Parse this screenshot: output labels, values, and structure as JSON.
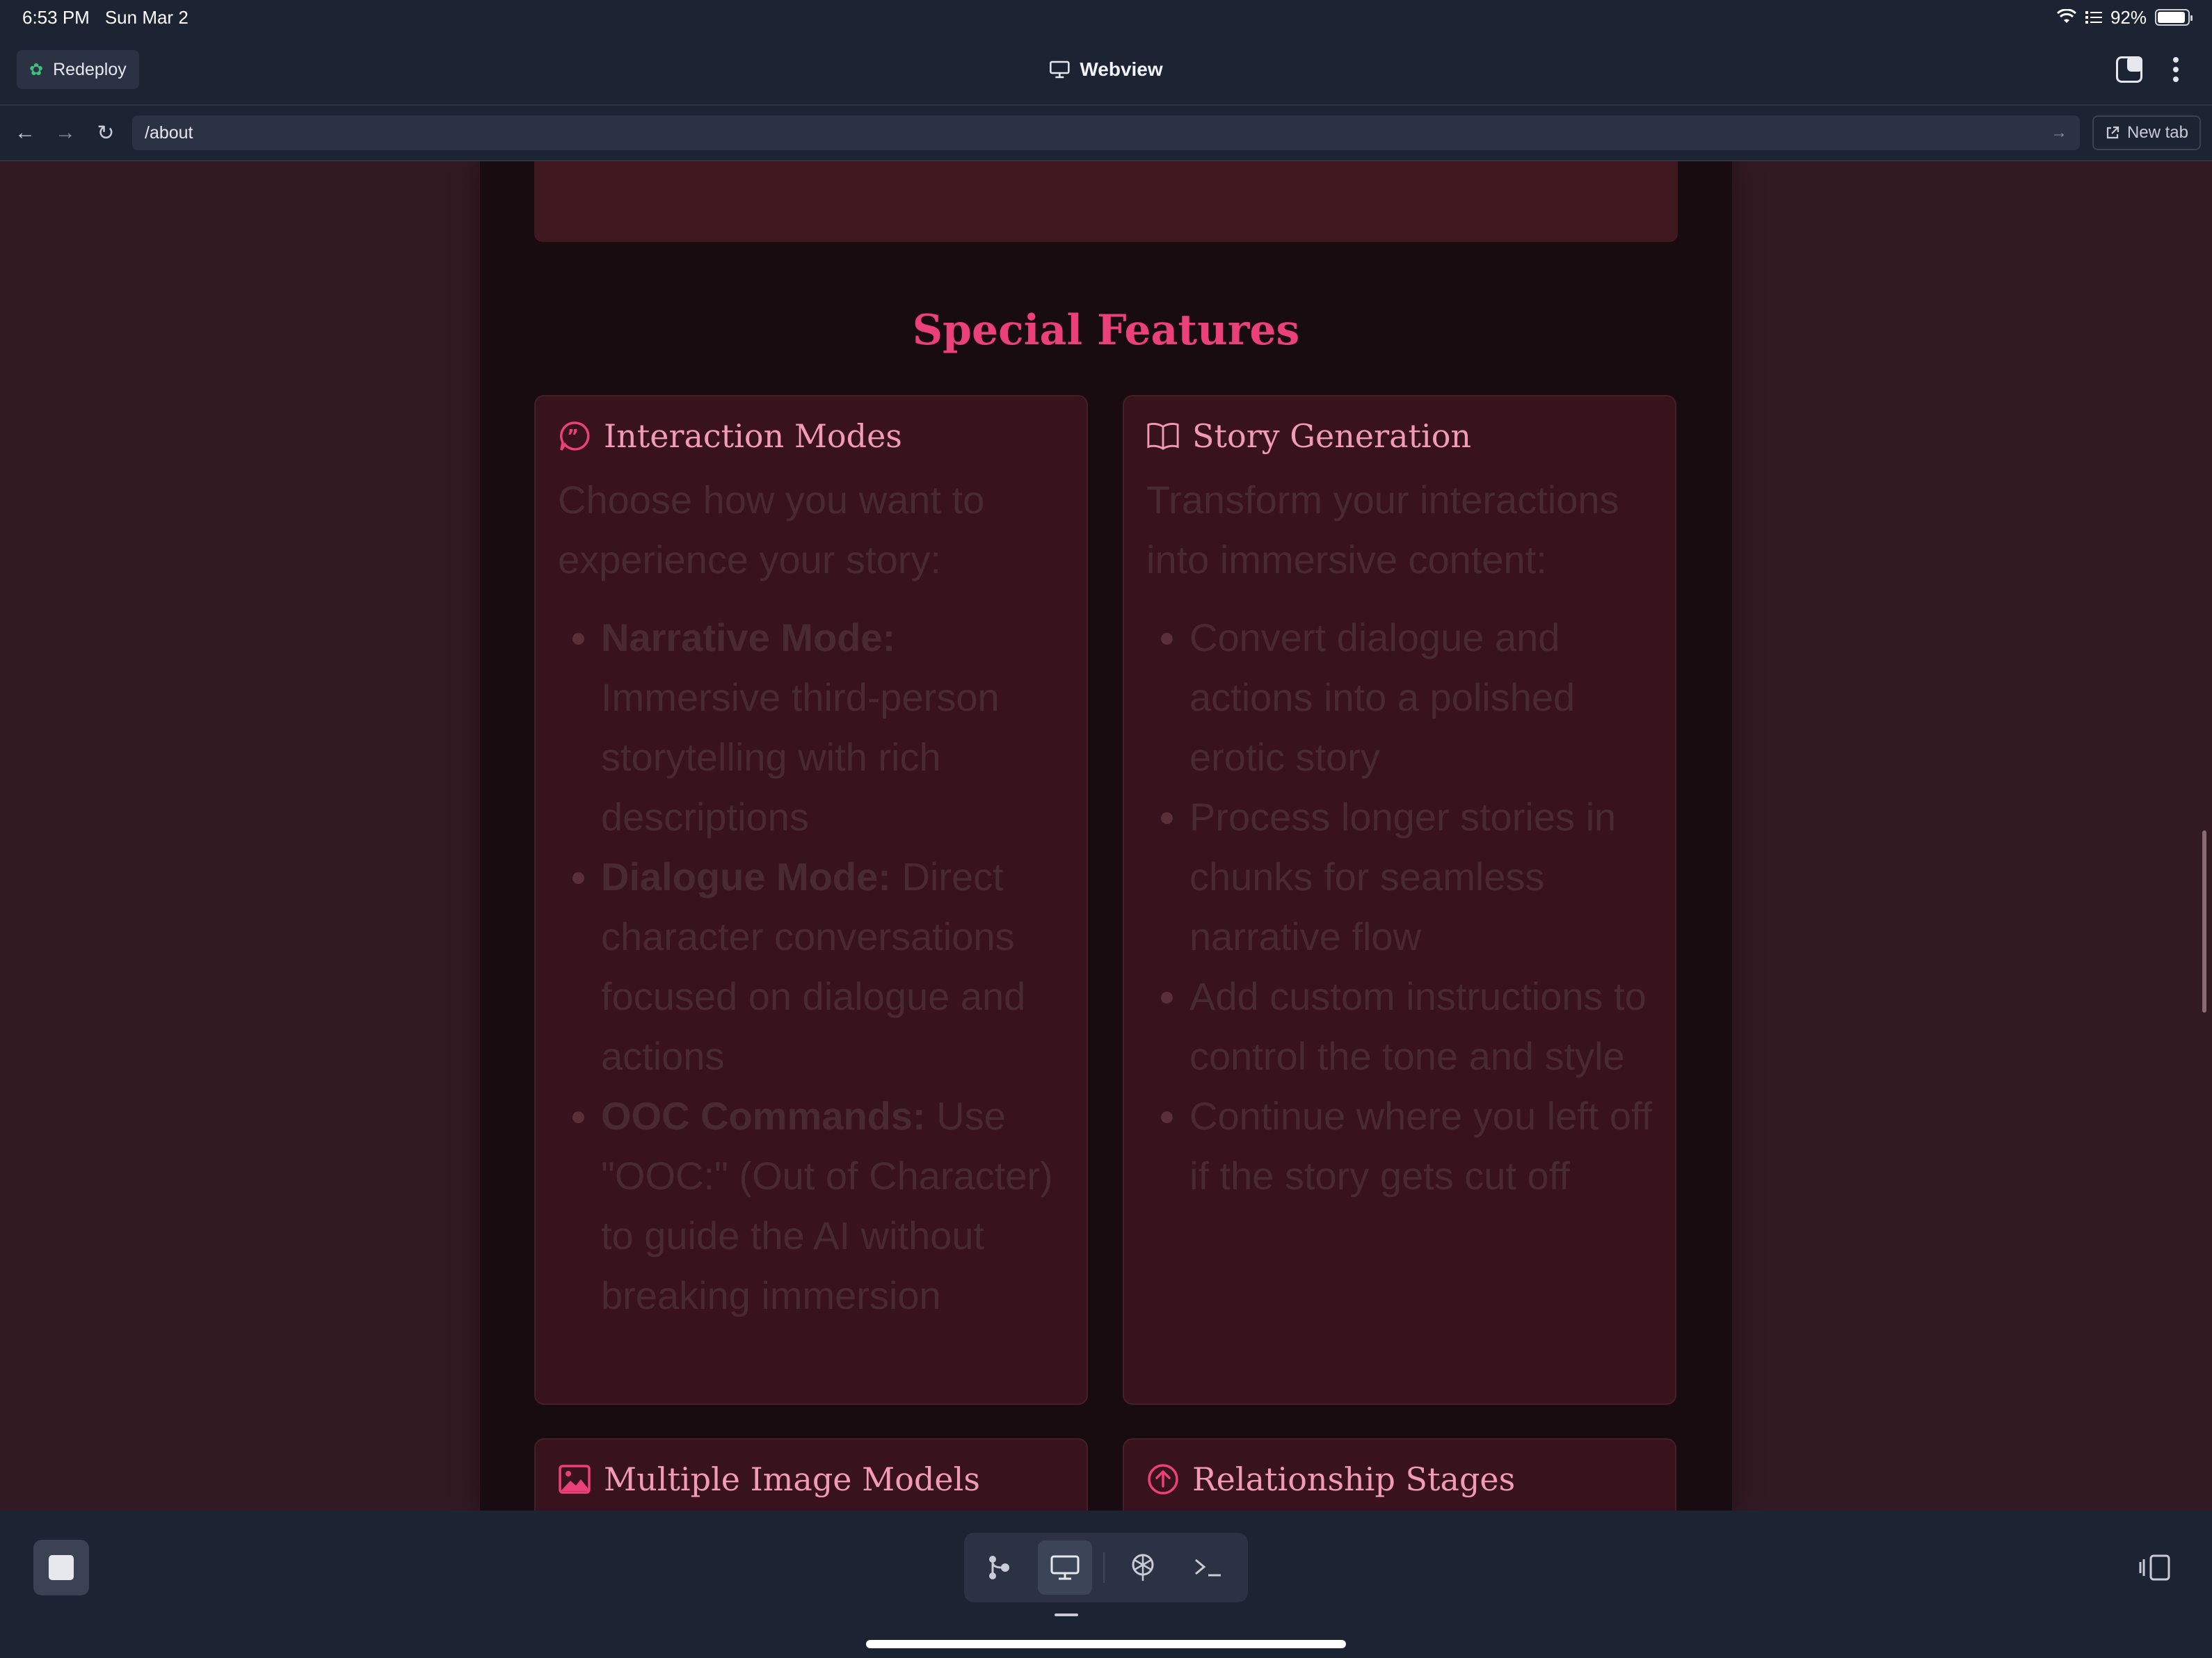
{
  "status_bar": {
    "time": "6:53 PM",
    "date": "Sun Mar 2",
    "battery": "92%",
    "battery_level": 0.92
  },
  "app_header": {
    "redeploy_label": "Redeploy",
    "title": "Webview"
  },
  "url_bar": {
    "url": "/about",
    "new_tab_label": "New tab"
  },
  "page": {
    "section_title": "Special Features",
    "cards": [
      {
        "icon": "quote-bubble-icon",
        "title": "Interaction Modes",
        "intro": "Choose how you want to experience your story:",
        "items": [
          {
            "bold": "Narrative Mode:",
            "text": " Immersive third-person storytelling with rich descriptions"
          },
          {
            "bold": "Dialogue Mode:",
            "text": " Direct character conversations focused on dialogue and actions"
          },
          {
            "bold": "OOC Commands:",
            "text": " Use \"OOC:\" (Out of Character) to guide the AI without breaking immersion"
          }
        ]
      },
      {
        "icon": "open-book-icon",
        "title": "Story Generation",
        "intro": "Transform your interactions into immersive content:",
        "items": [
          {
            "bold": "",
            "text": "Convert dialogue and actions into a polished erotic story"
          },
          {
            "bold": "",
            "text": "Process longer stories in chunks for seamless narrative flow"
          },
          {
            "bold": "",
            "text": "Add custom instructions to control the tone and style"
          },
          {
            "bold": "",
            "text": "Continue where you left off if the story gets cut off"
          }
        ]
      },
      {
        "icon": "image-icon",
        "title": "Multiple Image Models"
      },
      {
        "icon": "arrow-up-circle-icon",
        "title": "Relationship Stages"
      }
    ]
  },
  "colors": {
    "accent": "#ec407a",
    "card_title": "#f29ab8",
    "card_bg": "#38121c",
    "page_bg": "#180c10",
    "outer_bg": "#321a22",
    "chrome_bg": "#1c2333"
  }
}
